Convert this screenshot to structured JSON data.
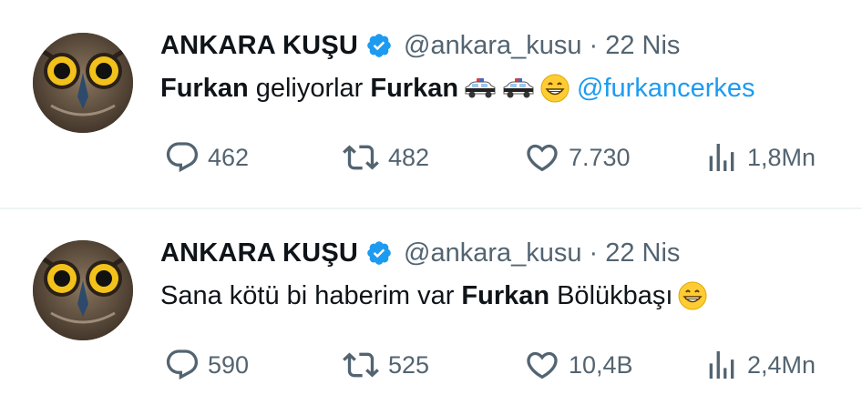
{
  "tweets": [
    {
      "author": {
        "name": "ANKARA KUŞU",
        "handle": "@ankara_kusu"
      },
      "separator": "·",
      "date": "22 Nis",
      "text": {
        "w1": "Furkan",
        "w2": "geliyorlar",
        "w3": "Furkan",
        "mention": "@furkancerkes"
      },
      "emojis": [
        "police-car-emoji",
        "police-car-emoji",
        "grinning-face-emoji"
      ],
      "stats": {
        "replies": "462",
        "retweets": "482",
        "likes": "7.730",
        "views": "1,8Mn"
      }
    },
    {
      "author": {
        "name": "ANKARA KUŞU",
        "handle": "@ankara_kusu"
      },
      "separator": "·",
      "date": "22 Nis",
      "text": {
        "pre": "Sana kötü bi haberim var",
        "bold": "Furkan",
        "post": "Bölükbaşı"
      },
      "emojis": [
        "grinning-face-emoji"
      ],
      "stats": {
        "replies": "590",
        "retweets": "525",
        "likes": "10,4B",
        "views": "2,4Mn"
      }
    }
  ],
  "colors": {
    "text": "#0f1419",
    "secondary": "#536471",
    "link": "#1d9bf0",
    "verified": "#1d9bf0",
    "divider": "#eff3f4"
  }
}
